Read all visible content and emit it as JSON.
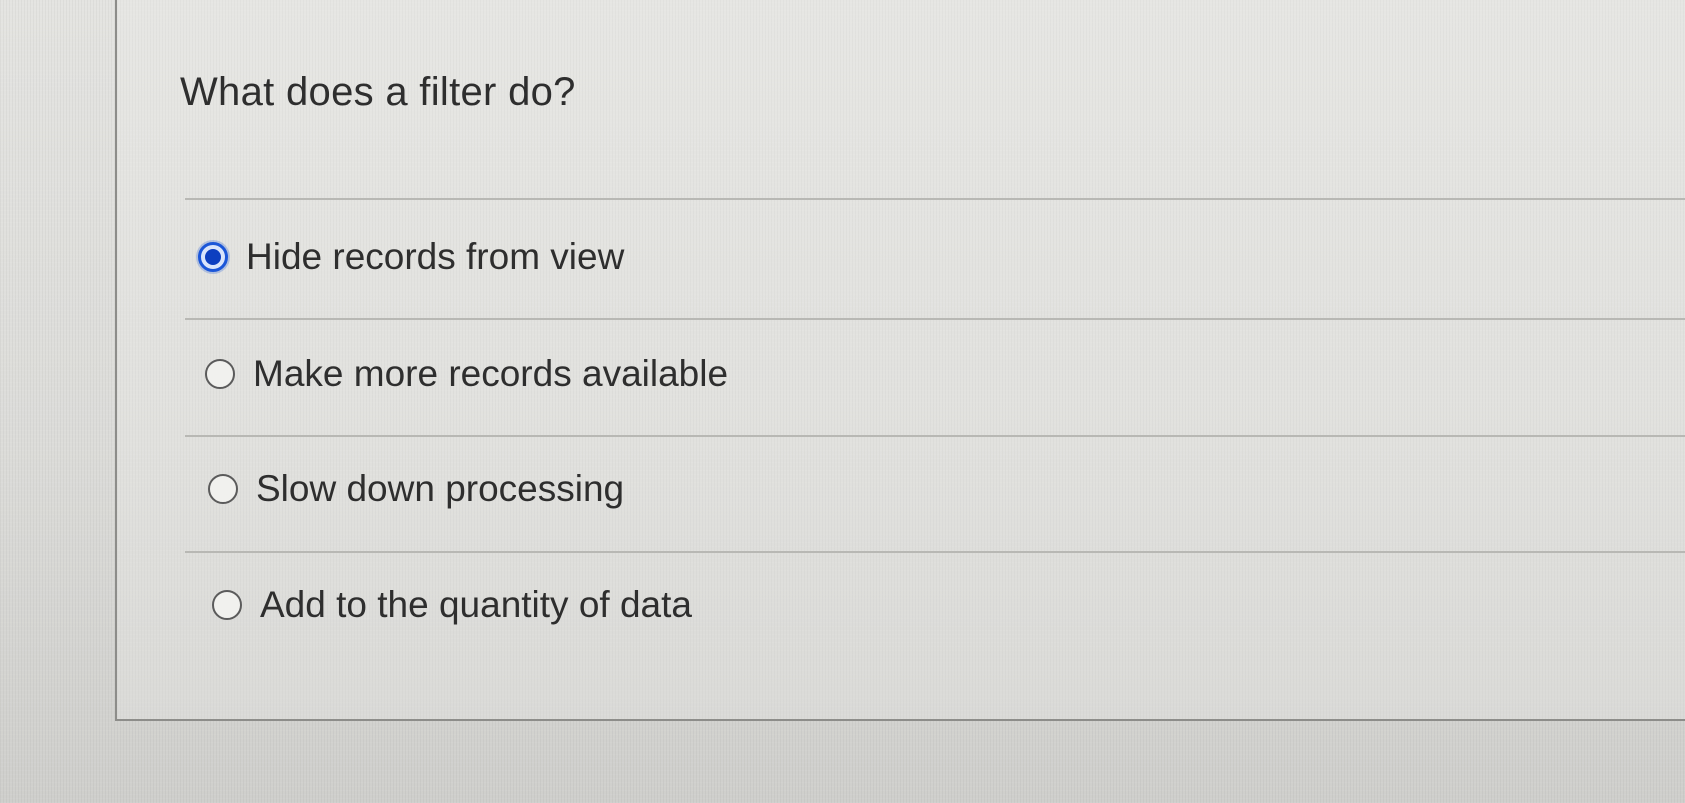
{
  "question": {
    "text": "What does a filter do?"
  },
  "options": [
    {
      "label": "Hide records from view",
      "selected": true
    },
    {
      "label": "Make more records available",
      "selected": false
    },
    {
      "label": "Slow down processing",
      "selected": false
    },
    {
      "label": "Add to the quantity of data",
      "selected": false
    }
  ],
  "icons": {
    "radio_checked": "radio-checked-icon",
    "radio_unchecked": "radio-unchecked-icon"
  },
  "colors": {
    "selected_radio": "#1b56d8",
    "text": "#2e2e2e",
    "background": "#dcdcd9"
  }
}
